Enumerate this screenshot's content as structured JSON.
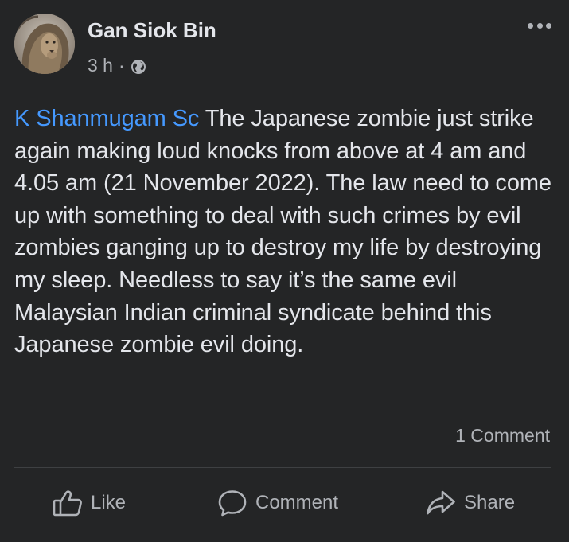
{
  "post": {
    "author": "Gan Siok Bin",
    "time": "3 h",
    "separator": "·",
    "privacy_icon": "globe-icon",
    "more_icon": "more-options-icon",
    "mention": "K Shanmugam Sc",
    "body": " The Japanese zombie just strike again making loud knocks from above at 4 am and 4.05 am (21 November 2022). The law need to come up with something to deal with such crimes by evil zombies ganging up to destroy my life by destroying my sleep. Needless to say it’s the same evil Malaysian Indian criminal syndicate behind this Japanese zombie evil doing.",
    "comment_count": "1 Comment"
  },
  "actions": {
    "like": {
      "label": "Like",
      "icon": "thumbs-up-icon"
    },
    "comment": {
      "label": "Comment",
      "icon": "comment-bubble-icon"
    },
    "share": {
      "label": "Share",
      "icon": "share-arrow-icon"
    }
  },
  "colors": {
    "background": "#242526",
    "primary_text": "#e4e6eb",
    "secondary_text": "#b0b3b8",
    "mention": "#4599ff",
    "divider": "#3e4042"
  }
}
